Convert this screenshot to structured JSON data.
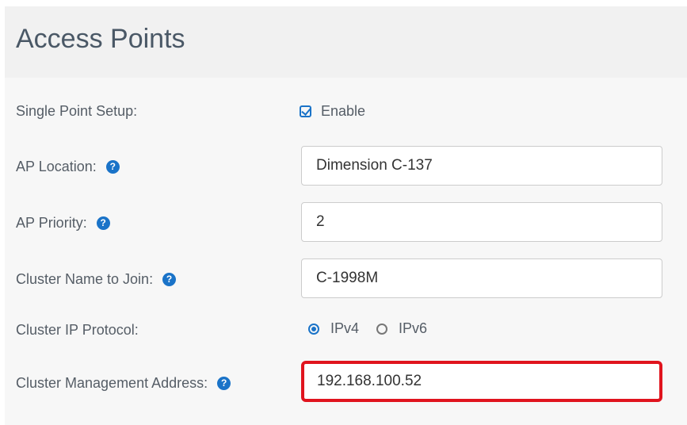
{
  "header": {
    "title": "Access Points"
  },
  "fields": {
    "single_point_setup": {
      "label": "Single Point Setup:",
      "checkbox_label": "Enable",
      "checked": true
    },
    "ap_location": {
      "label": "AP Location:",
      "value": "Dimension C-137"
    },
    "ap_priority": {
      "label": "AP Priority:",
      "value": "2"
    },
    "cluster_name": {
      "label": "Cluster Name to Join:",
      "value": "C-1998M"
    },
    "cluster_ip_protocol": {
      "label": "Cluster IP Protocol:",
      "options": [
        "IPv4",
        "IPv6"
      ],
      "selected": "IPv4"
    },
    "cluster_management_address": {
      "label": "Cluster Management Address:",
      "value": "192.168.100.52"
    }
  },
  "icons": {
    "help": "question-circle-icon",
    "help_glyph": "?"
  },
  "colors": {
    "accent": "#1a73c8",
    "highlight_border": "#e0141e",
    "label_text": "#555d66",
    "header_bg": "#f1f1f1",
    "form_bg": "#f7f7f7"
  }
}
